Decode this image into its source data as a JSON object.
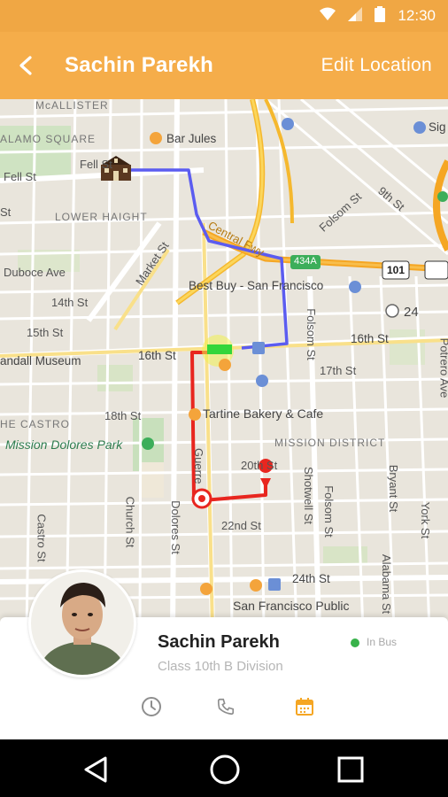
{
  "status_bar": {
    "time": "12:30"
  },
  "app_bar": {
    "title": "Sachin Parekh",
    "action": "Edit Location"
  },
  "map": {
    "labels": {
      "mcallister": "McALLISTER",
      "alamo_square": "ALAMO SQUARE",
      "bar_jules": "Bar Jules",
      "fell_st_1": "Fell St",
      "fell_st_2": "Fell St",
      "st_left": "St",
      "lower_haight": "LOWER HAIGHT",
      "central_fwy": "Central Fwy",
      "folsom_st_top": "Folsom St",
      "ninth_st": "9th St",
      "sig": "Sig",
      "duboce_ave": "Duboce Ave",
      "market_st": "Market St",
      "i434": "434A",
      "us101": "101",
      "best_buy": "Best Buy - San Francisco",
      "fourteenth_st": "14th St",
      "fifteenth_st": "15th St",
      "twentyfour": "24",
      "sixteenth_st_left": "16th St",
      "sixteenth_st_right": "16th St",
      "potrero_ave": "Potrero Ave",
      "randall_museum": "andall Museum",
      "seventeenth_st": "17th St",
      "folsom_st": "Folsom St",
      "the_castro": "HE CASTRO",
      "eighteenth_st": "18th St",
      "tartine": "Tartine Bakery & Cafe",
      "mission_dolores_park": "Mission Dolores Park",
      "mission_district": "MISSION DISTRICT",
      "guerrero": "Guerre",
      "twentieth_st": "20th St",
      "shotwell_st": "Shotwell St",
      "folsom_st_2": "Folsom St",
      "bryant_st": "Bryant St",
      "york_st": "York St",
      "church_st": "Church St",
      "castro_st": "Castro St",
      "dolores_st": "Dolores St",
      "twentysecond_st": "22nd St",
      "alabama_st": "Alabama St",
      "twentyfourth_st": "24th St",
      "sf_public": "San Francisco Public"
    }
  },
  "student": {
    "name": "Sachin Parekh",
    "class": "Class 10th B Division",
    "status": "In Bus"
  },
  "colors": {
    "accent": "#f5ad4a",
    "status_bar": "#f0a744",
    "route_blue": "#5b5cf0",
    "route_red": "#e8261f",
    "online": "#38b24a"
  },
  "icons": [
    "back-arrow-icon",
    "wifi-icon",
    "signal-icon",
    "battery-icon",
    "school-icon",
    "clock-icon",
    "phone-icon",
    "calendar-icon",
    "nav-back-icon",
    "nav-home-icon",
    "nav-recents-icon"
  ]
}
